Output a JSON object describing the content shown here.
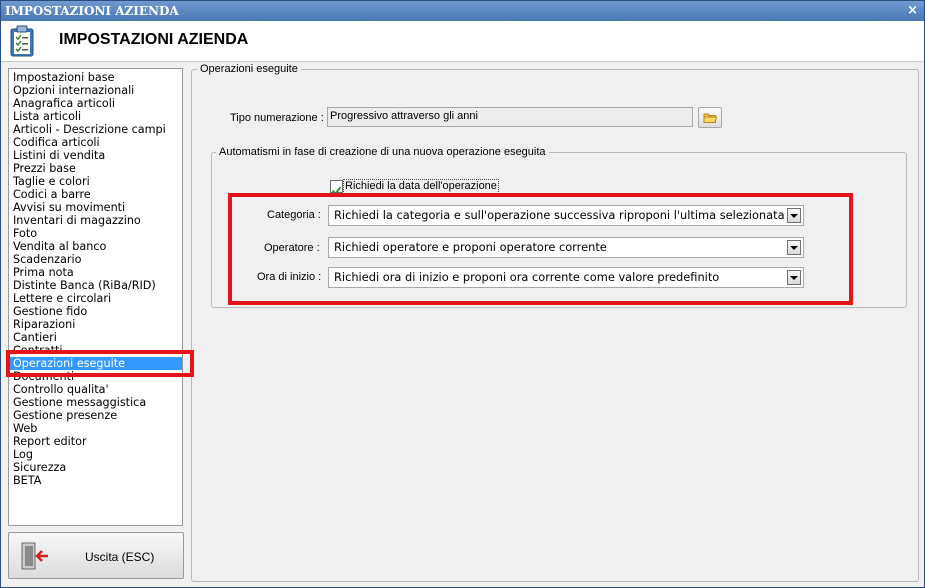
{
  "window": {
    "title": "IMPOSTAZIONI AZIENDA",
    "close_glyph": "×"
  },
  "header": {
    "title": "IMPOSTAZIONI AZIENDA",
    "icon": "clipboard-checklist-icon"
  },
  "nav": {
    "items": [
      "Impostazioni base",
      "Opzioni internazionali",
      "Anagrafica articoli",
      "Lista articoli",
      "Articoli - Descrizione campi",
      "Codifica articoli",
      "Listini di vendita",
      "Prezzi base",
      "Taglie e colori",
      "Codici a barre",
      "Avvisi su movimenti",
      "Inventari di magazzino",
      "Foto",
      "Vendita al banco",
      "Scadenzario",
      "Prima nota",
      "Distinte Banca (RiBa/RID)",
      "Lettere e circolari",
      "Gestione fido",
      "Riparazioni",
      "Cantieri",
      "Contratti",
      "Operazioni eseguite",
      "Documenti",
      "Controllo qualita'",
      "Gestione messaggistica",
      "Gestione presenze",
      "Web",
      "Report editor",
      "Log",
      "Sicurezza",
      "BETA"
    ],
    "selected": "Operazioni eseguite"
  },
  "exit_button": {
    "label": "Uscita (ESC)",
    "icon": "exit-door-icon"
  },
  "panel": {
    "title": "Operazioni eseguite",
    "numbering": {
      "label": "Tipo numerazione :",
      "value": "Progressivo attraverso gli anni",
      "button_icon": "folder-icon"
    },
    "group": {
      "title": "Automatismi in fase di creazione di una nuova operazione eseguita",
      "checkbox": {
        "label": "Richiedi la data dell'operazione",
        "checked": true
      },
      "fields": [
        {
          "label": "Categoria :",
          "value": "Richiedi la categoria e sull'operazione successiva riproponi l'ultima selezionata"
        },
        {
          "label": "Operatore :",
          "value": "Richiedi operatore e proponi operatore corrente"
        },
        {
          "label": "Ora di inizio :",
          "value": "Richiedi ora di inizio e proponi ora corrente come valore predefinito"
        }
      ]
    }
  },
  "highlight_color": "#e3141b",
  "selection_color": "#3399ff"
}
